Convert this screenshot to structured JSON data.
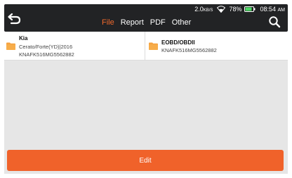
{
  "header": {
    "back_icon": "back-arrow-icon",
    "tabs": [
      {
        "label": "File",
        "active": true
      },
      {
        "label": "Report",
        "active": false
      },
      {
        "label": "PDF",
        "active": false
      },
      {
        "label": "Other",
        "active": false
      }
    ],
    "search_icon": "search-icon",
    "accent_color": "#f0692c"
  },
  "status_bar": {
    "speed": "2.0",
    "speed_unit": "KB/S",
    "battery_percent": "78%",
    "time": "08:54",
    "ampm": "AM",
    "battery_color": "#4cd964"
  },
  "files": [
    {
      "title": "Kia",
      "line1": "Cerato/Forte(YD)|2016",
      "line2": "KNAFK516MG5562882",
      "icon": "folder-icon"
    },
    {
      "title": "EOBD/OBDII",
      "line1": "KNAFK516MG5562882",
      "icon": "folder-icon"
    }
  ],
  "edit_button": {
    "label": "Edit",
    "color": "#f0622a"
  }
}
